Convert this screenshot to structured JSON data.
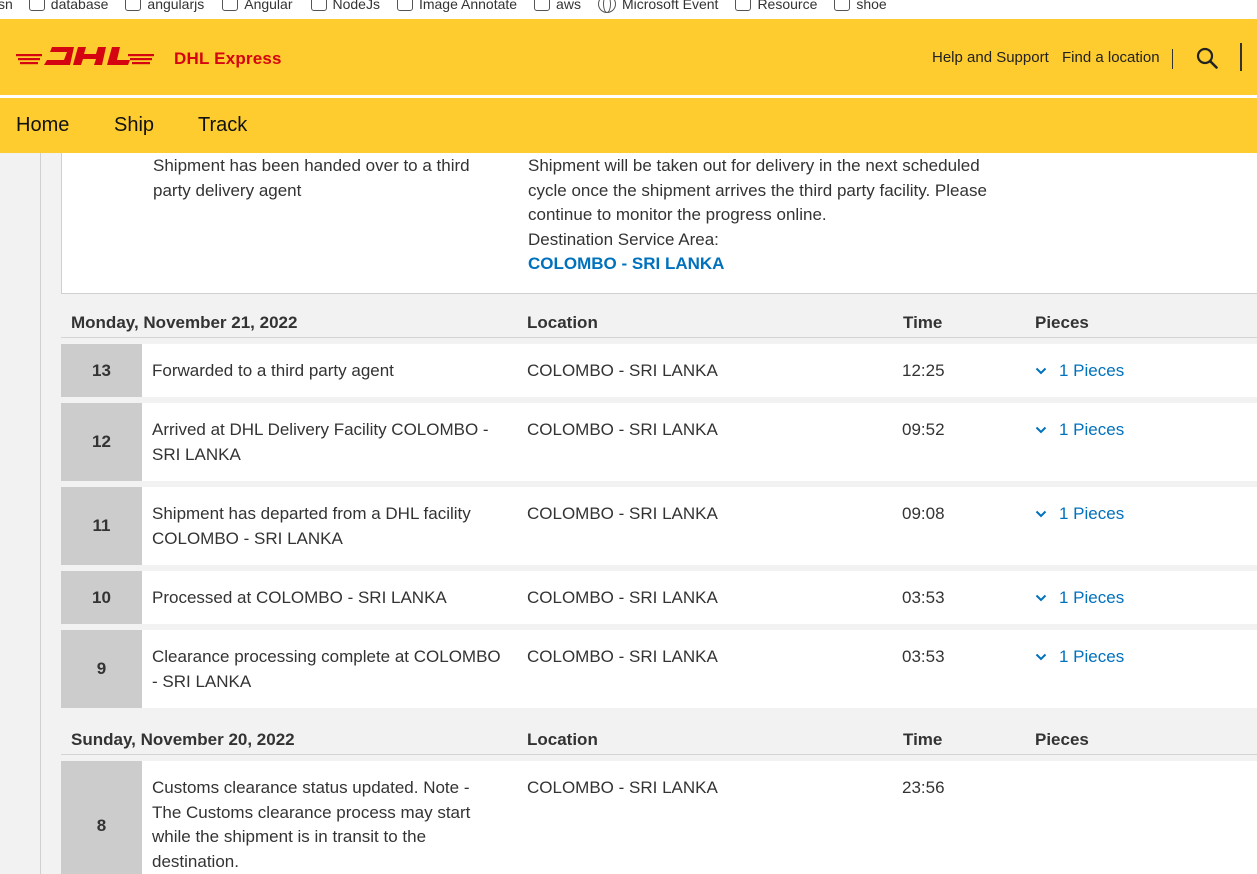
{
  "bookmarks": [
    {
      "label": "sn",
      "icon": "none"
    },
    {
      "label": "database",
      "icon": "folder-icon"
    },
    {
      "label": "angularjs",
      "icon": "folder-icon"
    },
    {
      "label": "Angular",
      "icon": "folder-icon"
    },
    {
      "label": "NodeJs",
      "icon": "folder-icon"
    },
    {
      "label": "Image Annotate",
      "icon": "folder-icon"
    },
    {
      "label": "aws",
      "icon": "folder-icon"
    },
    {
      "label": "Microsoft Event",
      "icon": "globe-icon"
    },
    {
      "label": "Resource",
      "icon": "folder-icon"
    },
    {
      "label": "shoe",
      "icon": "folder-icon"
    }
  ],
  "header": {
    "brand": "DHL Express",
    "help_link": "Help and Support",
    "find_link": "Find a location",
    "colors": {
      "yellow": "#fecc2f",
      "red": "#d40511",
      "link_blue": "#0071bc"
    }
  },
  "nav": {
    "home": "Home",
    "ship": "Ship",
    "track": "Track"
  },
  "top_event": {
    "description": "Shipment has been handed over to a third party delivery agent",
    "detail": "Shipment will be taken out for delivery in the next scheduled cycle once the shipment arrives the third party facility. Please continue to monitor the progress online.",
    "dest_label": "Destination Service Area:",
    "dest_value": "COLOMBO - SRI LANKA"
  },
  "days": [
    {
      "date": "Monday, November 21, 2022",
      "col_location": "Location",
      "col_time": "Time",
      "col_pieces": "Pieces",
      "events": [
        {
          "num": "13",
          "description": "Forwarded to a third party agent",
          "location": "COLOMBO - SRI LANKA",
          "time": "12:25",
          "pieces": "1 Pieces"
        },
        {
          "num": "12",
          "description": "Arrived at DHL Delivery Facility COLOMBO - SRI LANKA",
          "location": "COLOMBO - SRI LANKA",
          "time": "09:52",
          "pieces": "1 Pieces"
        },
        {
          "num": "11",
          "description": "Shipment has departed from a DHL facility COLOMBO - SRI LANKA",
          "location": "COLOMBO - SRI LANKA",
          "time": "09:08",
          "pieces": "1 Pieces"
        },
        {
          "num": "10",
          "description": "Processed at COLOMBO - SRI LANKA",
          "location": "COLOMBO - SRI LANKA",
          "time": "03:53",
          "pieces": "1 Pieces"
        },
        {
          "num": "9",
          "description": "Clearance processing complete at COLOMBO - SRI LANKA",
          "location": "COLOMBO - SRI LANKA",
          "time": "03:53",
          "pieces": "1 Pieces"
        }
      ]
    },
    {
      "date": "Sunday, November 20, 2022",
      "col_location": "Location",
      "col_time": "Time",
      "col_pieces": "Pieces",
      "events": [
        {
          "num": "8",
          "description": "Customs clearance status updated. Note - The Customs clearance process may start while the shipment is in transit to the destination.",
          "location": "COLOMBO - SRI LANKA",
          "time": "23:56"
        }
      ]
    }
  ]
}
